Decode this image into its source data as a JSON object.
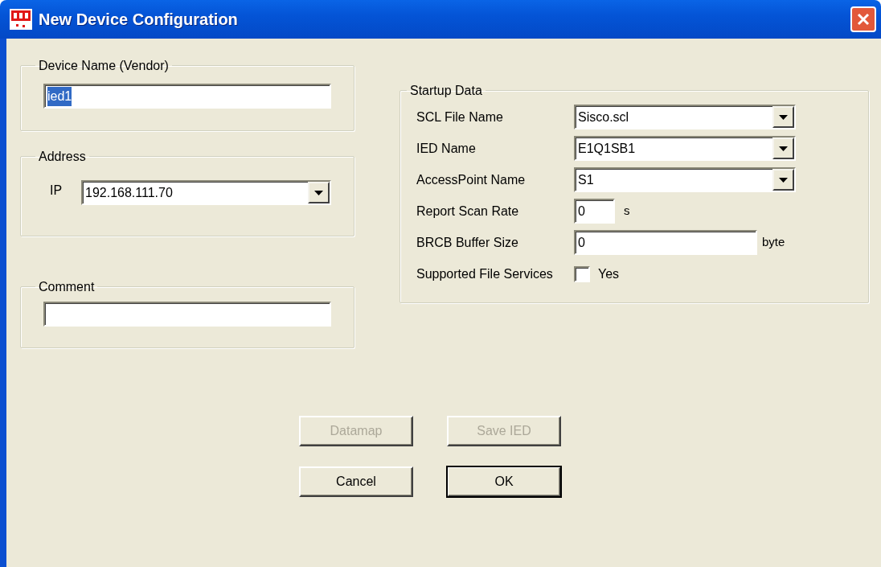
{
  "window": {
    "title": "New Device Configuration"
  },
  "device_name": {
    "legend": "Device Name (Vendor)",
    "value": "ied1",
    "text_selected": true
  },
  "address": {
    "legend": "Address",
    "ip_label": "IP",
    "ip_value": "192.168.111.70"
  },
  "comment": {
    "legend": "Comment"
  },
  "startup": {
    "legend": "Startup Data",
    "rows": [
      {
        "kind": "combo",
        "label": "SCL File Name",
        "value": "Sisco.scl"
      },
      {
        "kind": "combo",
        "label": "IED Name",
        "value": "E1Q1SB1"
      },
      {
        "kind": "combo",
        "label": "AccessPoint Name",
        "value": "S1"
      },
      {
        "kind": "short_text",
        "label": "Report Scan Rate",
        "value": "0",
        "unit": "s"
      },
      {
        "kind": "text",
        "label": "BRCB Buffer Size",
        "value": "0",
        "unit": "byte"
      },
      {
        "kind": "checkbox",
        "label": "Supported File Services",
        "option": "Yes",
        "checked": false
      }
    ]
  },
  "button_rows": [
    [
      {
        "label": "Datamap",
        "disabled": true,
        "default": false
      },
      {
        "label": "Save IED",
        "disabled": true,
        "default": false
      }
    ],
    [
      {
        "label": "Cancel",
        "disabled": false,
        "default": false
      },
      {
        "label": "OK",
        "disabled": false,
        "default": true
      }
    ]
  ]
}
